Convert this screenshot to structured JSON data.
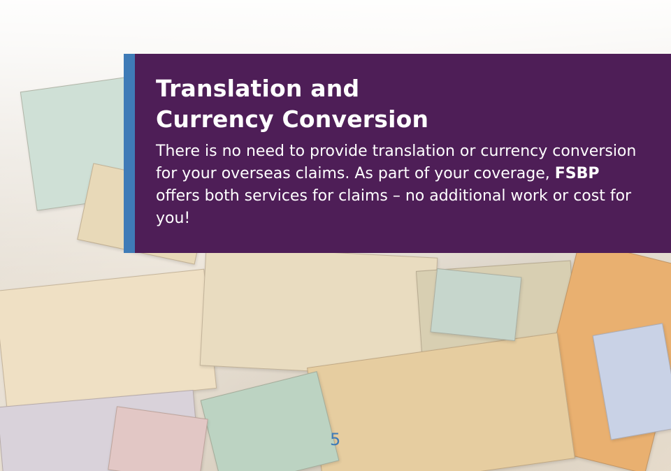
{
  "heading": {
    "line1": "Translation and",
    "line2": "Currency Conversion"
  },
  "body": {
    "text_before": "There is no need to provide translation or currency conversion for your overseas claims. As part of your coverage, ",
    "emphasis": "FSBP",
    "text_after": " offers both services for claims – no additional work or cost for you!"
  },
  "page_number": "5",
  "colors": {
    "panel_background": "#4e1e57",
    "accent_bar": "#3f7bb7",
    "heading_text": "#ffffff",
    "page_number": "#3f7bb7"
  },
  "background_image": "assorted-world-banknotes-photo"
}
